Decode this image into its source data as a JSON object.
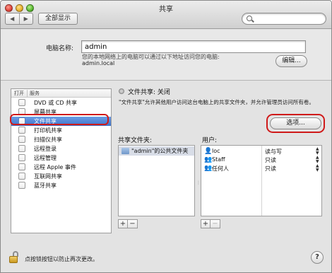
{
  "window": {
    "title": "共享"
  },
  "toolbar": {
    "back_glyph": "◀",
    "forward_glyph": "▶",
    "show_all_label": "全部显示",
    "search": {
      "value": "",
      "placeholder": ""
    }
  },
  "computer_name": {
    "label": "电脑名称:",
    "value": "admin",
    "description": "您的本地网络上的电脑可以通过以下地址访问您的电脑:",
    "local_address": "admin.local",
    "edit_label": "编辑..."
  },
  "services": {
    "header_on": "打开",
    "header_service": "服务",
    "items": [
      {
        "label": "DVD 或 CD 共享",
        "checked": false,
        "selected": false
      },
      {
        "label": "屏幕共享",
        "checked": false,
        "selected": false
      },
      {
        "label": "文件共享",
        "checked": false,
        "selected": true
      },
      {
        "label": "打印机共享",
        "checked": false,
        "selected": false
      },
      {
        "label": "扫描仪共享",
        "checked": false,
        "selected": false
      },
      {
        "label": "远程登录",
        "checked": false,
        "selected": false
      },
      {
        "label": "远程管理",
        "checked": false,
        "selected": false
      },
      {
        "label": "远程 Apple 事件",
        "checked": false,
        "selected": false
      },
      {
        "label": "互联网共享",
        "checked": false,
        "selected": false
      },
      {
        "label": "蓝牙共享",
        "checked": false,
        "selected": false
      }
    ]
  },
  "file_sharing": {
    "status": "文件共享: 关闭",
    "description": "\"文件共享\"允许其他用户访问这台电脑上的共享文件夹，并允许管理员访问所有卷。",
    "options_label": "选项...",
    "shared_folders_label": "共享文件夹:",
    "users_label": "用户:",
    "folders": [
      {
        "label": "\"admin\"的公共文件夹"
      }
    ],
    "users": [
      {
        "icon": "single-user-icon",
        "name": "loc",
        "permission": "读与写"
      },
      {
        "icon": "group-icon",
        "name": "Staff",
        "permission": "只读"
      },
      {
        "icon": "everyone-icon",
        "name": "任何人",
        "permission": "只读"
      }
    ]
  },
  "controls": {
    "add": "+",
    "remove": "−"
  },
  "footer": {
    "lock_text": "点按锁按钮以防止再次更改。",
    "help": "?"
  },
  "colors": {
    "selection": "#4a7fd4",
    "highlight_red": "#d01a1a"
  }
}
